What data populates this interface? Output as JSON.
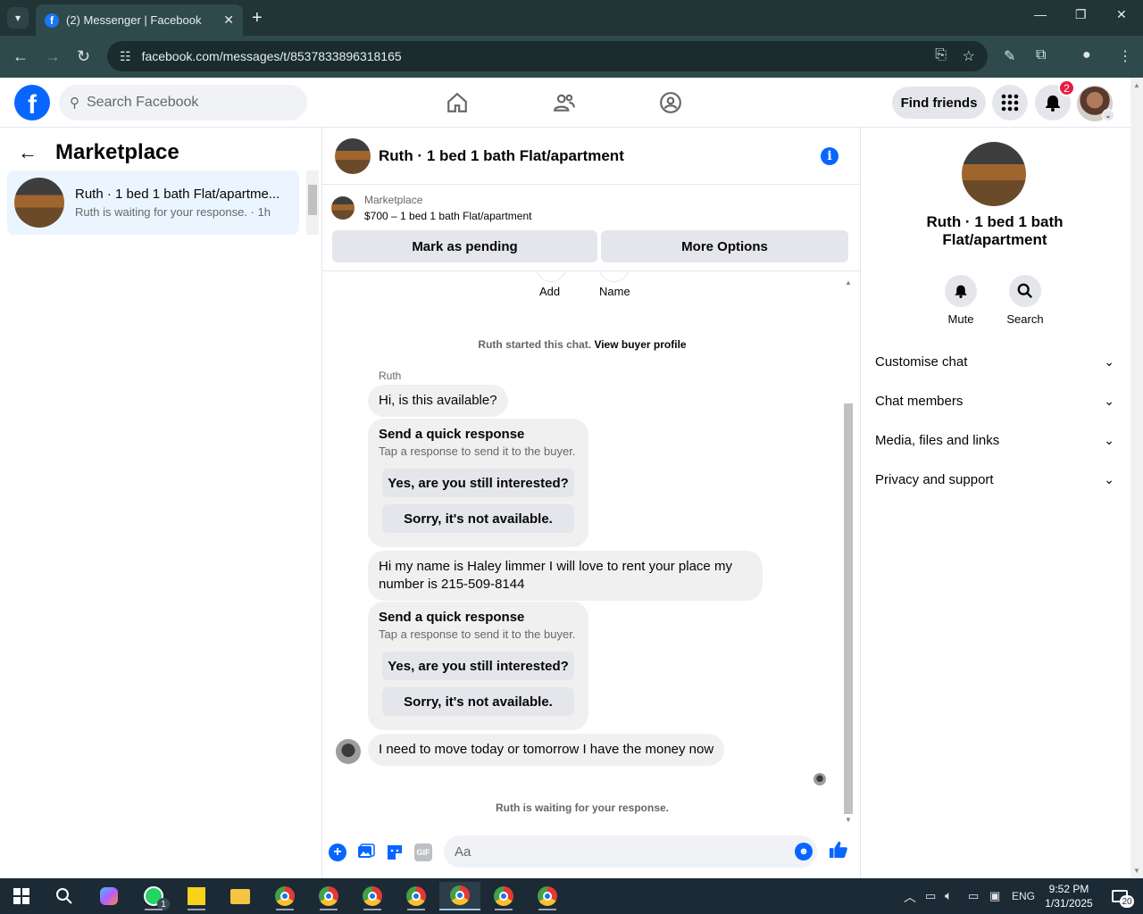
{
  "browser": {
    "tab_title": "(2) Messenger | Facebook",
    "url": "facebook.com/messages/t/8537833896318165"
  },
  "fb": {
    "search_placeholder": "Search Facebook",
    "find_friends": "Find friends",
    "notification_count": "2"
  },
  "left": {
    "title": "Marketplace",
    "conversation": {
      "name": "Ruth · 1 bed 1 bath Flat/apartme...",
      "subtitle": "Ruth is waiting for your response. · 1h"
    }
  },
  "chat": {
    "header_name": "Ruth · 1 bed 1 bath Flat/apartment",
    "listing_label": "Marketplace",
    "listing_price": "$700 – 1 bed 1 bath Flat/apartment",
    "mark_pending": "Mark as pending",
    "more_options": "More Options",
    "partial_labels": [
      "Add",
      "Name"
    ],
    "started_text": "Ruth started this chat.",
    "view_buyer": "View buyer profile",
    "sender_name": "Ruth",
    "messages": [
      "Hi, is this available?",
      "Hi my name is Haley limmer I will love to rent your place my number is 215-509-8144",
      "I need to move today or tomorrow I have the money now"
    ],
    "quick_response": {
      "title": "Send a quick response",
      "subtitle": "Tap a response to send it to the buyer.",
      "option_1": "Yes, are you still interested?",
      "option_2": "Sorry, it's not available."
    },
    "waiting_text": "Ruth is waiting for your response.",
    "composer_placeholder": "Aa",
    "gif_label": "GIF"
  },
  "right": {
    "name": "Ruth · 1 bed 1 bath Flat/apartment",
    "mute": "Mute",
    "search": "Search",
    "sections": [
      "Customise chat",
      "Chat members",
      "Media, files and links",
      "Privacy and support"
    ]
  },
  "taskbar": {
    "whatsapp_badge": "1",
    "lang": "ENG",
    "time": "9:52 PM",
    "date": "1/31/2025",
    "notif_count": "20"
  }
}
